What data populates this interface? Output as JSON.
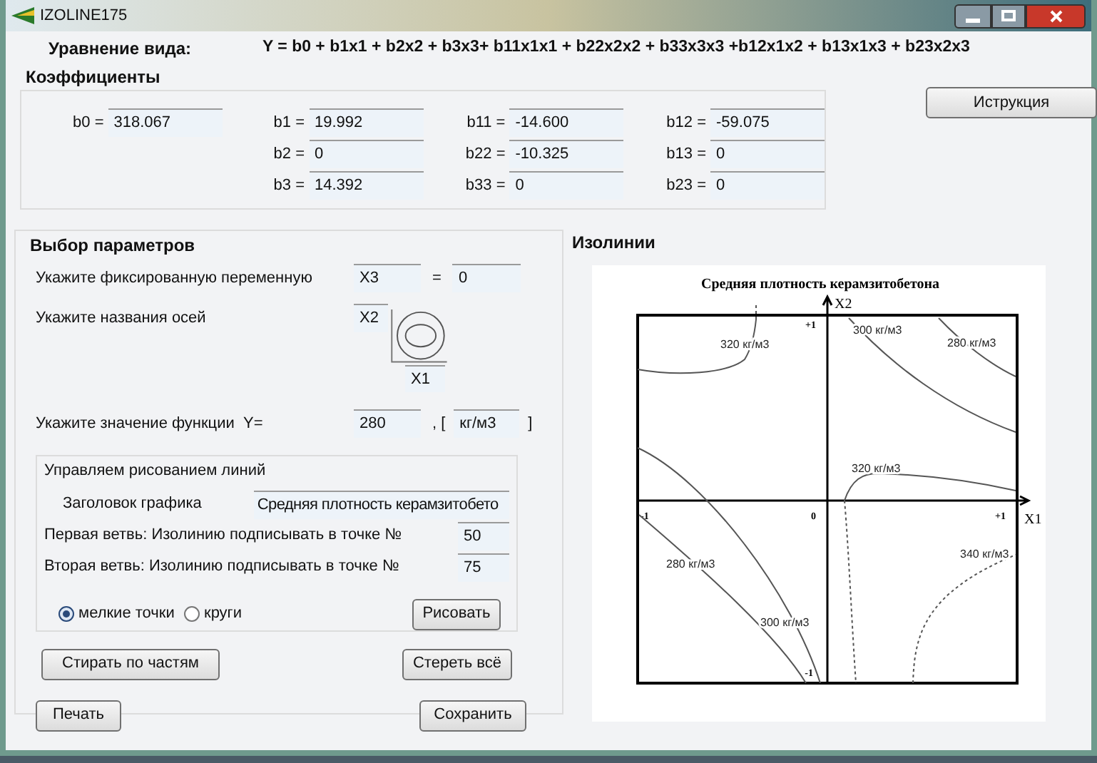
{
  "window": {
    "title": "IZOLINE175"
  },
  "equation": {
    "label": "Уравнение вида:",
    "formula": "Y = b0 + b1x1 + b2x2 + b3x3+ b11x1x1 + b22x2x2 + b33x3x3 +b12x1x2 + b13x1x3 + b23x2x3"
  },
  "coefficients": {
    "title": "Коэффициенты",
    "columns": [
      [
        {
          "label": "b0 =",
          "value": "318.067"
        }
      ],
      [
        {
          "label": "b1 =",
          "value": "19.992"
        },
        {
          "label": "b2 =",
          "value": "0"
        },
        {
          "label": "b3 =",
          "value": "14.392"
        }
      ],
      [
        {
          "label": "b11 =",
          "value": "-14.600"
        },
        {
          "label": "b22 =",
          "value": "-10.325"
        },
        {
          "label": "b33 =",
          "value": "0"
        }
      ],
      [
        {
          "label": "b12 =",
          "value": "-59.075"
        },
        {
          "label": "b13 =",
          "value": "0"
        },
        {
          "label": "b23 =",
          "value": "0"
        }
      ]
    ]
  },
  "instruction_button": "Иструкция",
  "parameters": {
    "title": "Выбор параметров",
    "fixed_variable": {
      "label": "Укажите фиксированную переменную",
      "variable": "X3",
      "equals": "=",
      "value": "0"
    },
    "axes": {
      "label": "Укажите названия осей",
      "y_axis": "X2",
      "x_axis": "X1"
    },
    "function_value": {
      "label": "Укажите значение функции  Y=",
      "value": "280",
      "unit_open": ", [",
      "unit": "кг/м3",
      "unit_close": "]"
    },
    "drawing": {
      "title": "Управляем рисованием линий",
      "chart_title": {
        "label": "Заголовок графика",
        "value": "Средняя плотность керамзитобето"
      },
      "branches": [
        {
          "label": "Первая ветвь:",
          "text": "Изолинию подписывать в точке №",
          "value": "50"
        },
        {
          "label": "Вторая ветвь:",
          "text": "Изолинию подписывать в точке №",
          "value": "75"
        }
      ],
      "point_style": [
        {
          "label": "мелкие точки",
          "selected": true
        },
        {
          "label": "круги",
          "selected": false
        }
      ],
      "draw_button": "Рисовать"
    },
    "erase_parts_button": "Стирать по частям",
    "erase_all_button": "Стереть всё"
  },
  "print_button": "Печать",
  "save_button": "Сохранить",
  "isolines": {
    "title": "Изолинии",
    "chart": {
      "title": "Средняя плотность керамзитобетона",
      "x_axis": "X1",
      "y_axis": "X2",
      "ticks": [
        "+1",
        "0",
        "-1",
        "-1",
        "+1"
      ],
      "labels": [
        "320 кг/м3",
        "300 кг/м3",
        "280 кг/м3",
        "320 кг/м3",
        "280 кг/м3",
        "300 кг/м3",
        "340 кг/м3"
      ]
    }
  }
}
